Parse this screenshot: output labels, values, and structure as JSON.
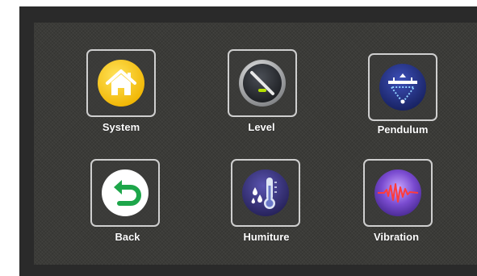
{
  "menu": {
    "items": [
      {
        "id": "system",
        "label": "System",
        "icon": "home-icon",
        "color": "#f7c600"
      },
      {
        "id": "level",
        "label": "Level",
        "icon": "level-gauge-icon",
        "color": "#2b2e33"
      },
      {
        "id": "pendulum",
        "label": "Pendulum",
        "icon": "pendulum-icon",
        "color": "#1e2f8a"
      },
      {
        "id": "back",
        "label": "Back",
        "icon": "back-arrow-icon",
        "color": "#1da64a"
      },
      {
        "id": "humiture",
        "label": "Humiture",
        "icon": "thermometer-icon",
        "color": "#3c3680"
      },
      {
        "id": "vibration",
        "label": "Vibration",
        "icon": "vibration-wave-icon",
        "color": "#5a33a5"
      }
    ]
  }
}
